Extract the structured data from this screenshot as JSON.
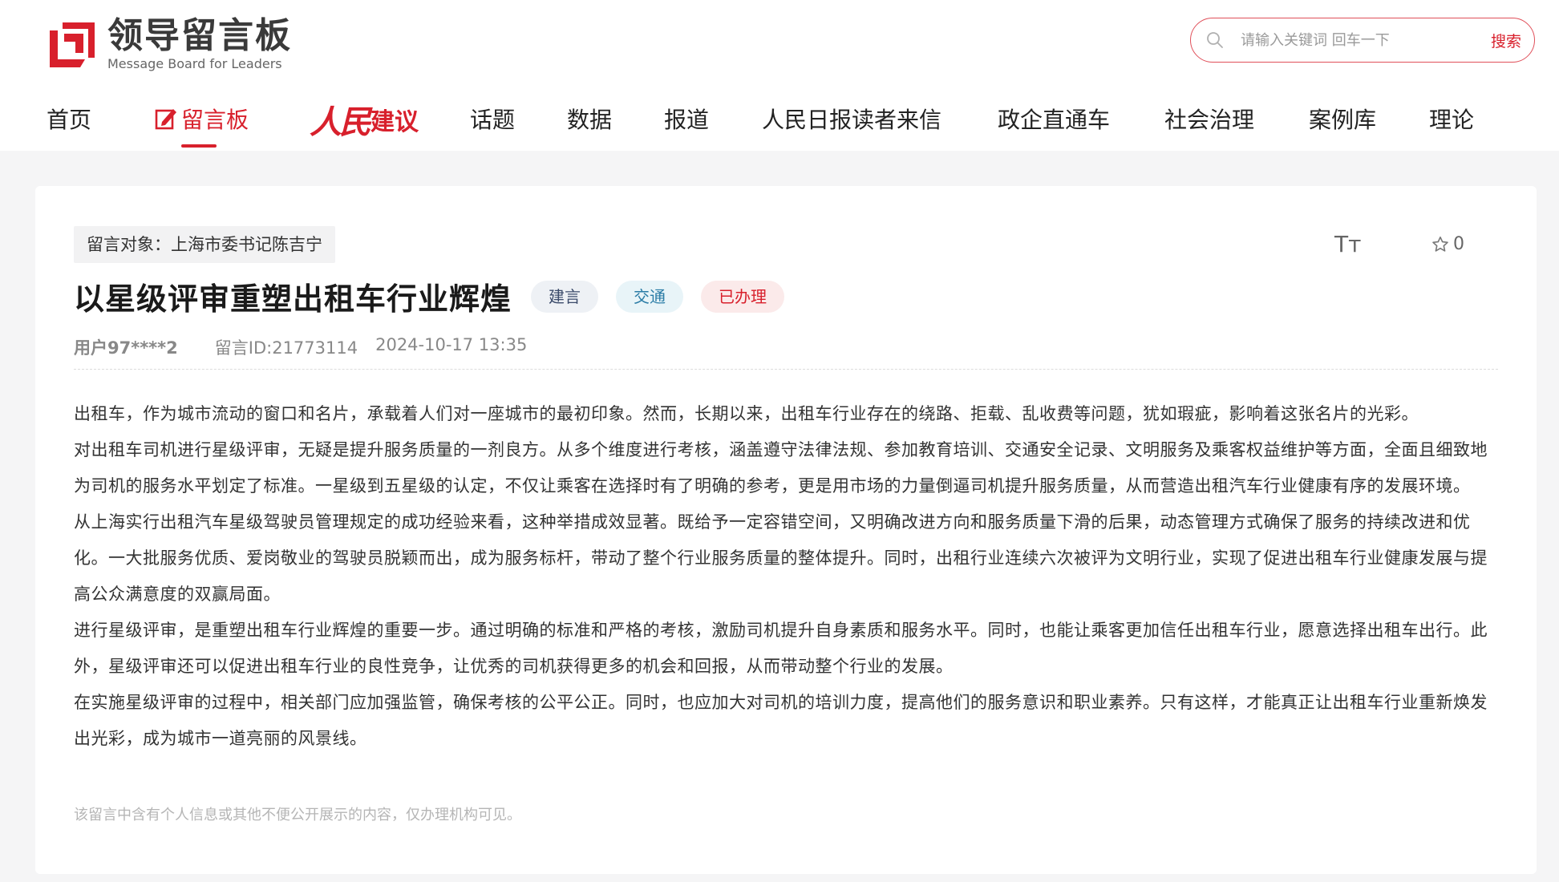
{
  "logo": {
    "cn": "领导留言板",
    "en": "Message Board for Leaders"
  },
  "search": {
    "placeholder": "请输入关键词 回车一下",
    "button": "搜索"
  },
  "nav": {
    "items": [
      {
        "label": "首页"
      },
      {
        "label": "留言板",
        "active": true
      },
      {
        "label_script": "人民",
        "label_rest": "建议"
      },
      {
        "label": "话题"
      },
      {
        "label": "数据"
      },
      {
        "label": "报道"
      },
      {
        "label": "人民日报读者来信"
      },
      {
        "label": "政企直通车"
      },
      {
        "label": "社会治理"
      },
      {
        "label": "案例库"
      },
      {
        "label": "理论"
      }
    ]
  },
  "message": {
    "target": "留言对象：上海市委书记陈吉宁",
    "font_toggle": "Tт",
    "favorite_count": "0",
    "title": "以星级评审重塑出租车行业辉煌",
    "badges": [
      "建言",
      "交通",
      "已办理"
    ],
    "user": "用户97****2",
    "message_id": "留言ID:21773114",
    "time": "2024-10-17 13:35",
    "paragraphs": [
      "出租车，作为城市流动的窗口和名片，承载着人们对一座城市的最初印象。然而，长期以来，出租车行业存在的绕路、拒载、乱收费等问题，犹如瑕疵，影响着这张名片的光彩。",
      "对出租车司机进行星级评审，无疑是提升服务质量的一剂良方。从多个维度进行考核，涵盖遵守法律法规、参加教育培训、交通安全记录、文明服务及乘客权益维护等方面，全面且细致地为司机的服务水平划定了标准。一星级到五星级的认定，不仅让乘客在选择时有了明确的参考，更是用市场的力量倒逼司机提升服务质量，从而营造出租汽车行业健康有序的发展环境。",
      "从上海实行出租汽车星级驾驶员管理规定的成功经验来看，这种举措成效显著。既给予一定容错空间，又明确改进方向和服务质量下滑的后果，动态管理方式确保了服务的持续改进和优化。一大批服务优质、爱岗敬业的驾驶员脱颖而出，成为服务标杆，带动了整个行业服务质量的整体提升。同时，出租行业连续六次被评为文明行业，实现了促进出租车行业健康发展与提高公众满意度的双赢局面。",
      "进行星级评审，是重塑出租车行业辉煌的重要一步。通过明确的标准和严格的考核，激励司机提升自身素质和服务水平。同时，也能让乘客更加信任出租车行业，愿意选择出租车出行。此外，星级评审还可以促进出租车行业的良性竞争，让优秀的司机获得更多的机会和回报，从而带动整个行业的发展。",
      "在实施星级评审的过程中，相关部门应加强监管，确保考核的公平公正。同时，也应加大对司机的培训力度，提高他们的服务意识和职业素养。只有这样，才能真正让出租车行业重新焕发出光彩，成为城市一道亮丽的风景线。"
    ],
    "privacy_note": "该留言中含有个人信息或其他不便公开展示的内容，仅办理机构可见。"
  },
  "colors": {
    "accent": "#d8202c",
    "background": "#f5f5f6"
  }
}
